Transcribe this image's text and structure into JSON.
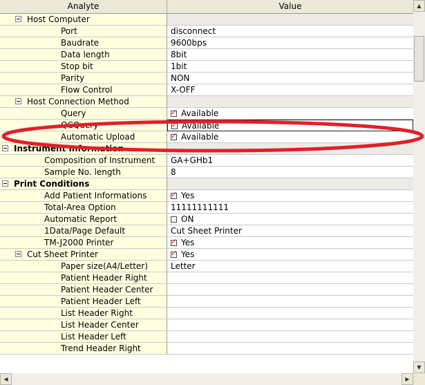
{
  "header": {
    "analyte": "Analyte",
    "value": "Value"
  },
  "rows": [
    {
      "label": "Host Computer",
      "value": "",
      "level": 1,
      "toggle": true,
      "bold": false,
      "group": true
    },
    {
      "label": "Port",
      "value": "disconnect",
      "level": 3
    },
    {
      "label": "Baudrate",
      "value": "9600bps",
      "level": 3
    },
    {
      "label": "Data length",
      "value": "8bit",
      "level": 3
    },
    {
      "label": "Stop bit",
      "value": "1bit",
      "level": 3
    },
    {
      "label": "Parity",
      "value": "NON",
      "level": 3
    },
    {
      "label": "Flow Control",
      "value": "X-OFF",
      "level": 3
    },
    {
      "label": "Host Connection Method",
      "value": "",
      "level": 1,
      "toggle": true,
      "group": true
    },
    {
      "label": "Query",
      "value": "Available",
      "level": 3,
      "checkbox": true,
      "checked": true
    },
    {
      "label": "QCQuery",
      "value": "Available",
      "level": 3,
      "checkbox": true,
      "checked": true,
      "selected": true
    },
    {
      "label": "Automatic Upload",
      "value": "Available",
      "level": 3,
      "checkbox": true,
      "checked": true
    },
    {
      "label": "Instrument Information",
      "value": "",
      "level": 0,
      "toggle": true,
      "bold": true,
      "group": true
    },
    {
      "label": "Composition of Instrument",
      "value": "GA+GHb1",
      "level": 2
    },
    {
      "label": "Sample No. length",
      "value": "8",
      "level": 2
    },
    {
      "label": "Print Conditions",
      "value": "",
      "level": 0,
      "toggle": true,
      "bold": true,
      "group": true
    },
    {
      "label": "Add Patient Informations",
      "value": "Yes",
      "level": 2,
      "checkbox": true,
      "checked": true
    },
    {
      "label": "Total-Area Option",
      "value": "11111111111",
      "level": 2
    },
    {
      "label": "Automatic Report",
      "value": "ON",
      "level": 2,
      "checkbox": true,
      "checked": false
    },
    {
      "label": "1Data/Page Default",
      "value": "Cut Sheet Printer",
      "level": 2
    },
    {
      "label": "TM-J2000 Printer",
      "value": "Yes",
      "level": 2,
      "checkbox": true,
      "checked": true
    },
    {
      "label": "Cut Sheet Printer",
      "value": "Yes",
      "level": 1,
      "toggle": true,
      "checkbox": true,
      "checked": true
    },
    {
      "label": "Paper size(A4/Letter)",
      "value": "Letter",
      "level": 3
    },
    {
      "label": "Patient Header Right",
      "value": "",
      "level": 3
    },
    {
      "label": "Patient Header Center",
      "value": "",
      "level": 3
    },
    {
      "label": "Patient Header Left",
      "value": "",
      "level": 3
    },
    {
      "label": "List Header Right",
      "value": "",
      "level": 3
    },
    {
      "label": "List Header Center",
      "value": "",
      "level": 3
    },
    {
      "label": "List Header Left",
      "value": "",
      "level": 3
    },
    {
      "label": "Trend Header Right",
      "value": "",
      "level": 3
    }
  ],
  "colors": {
    "label_bg": "#ffffe0",
    "group_value_bg": "#ecebe6",
    "check": "#e0202a",
    "highlight": "#e0202a"
  },
  "icons": {
    "toggle": "minus-box-icon",
    "check": "red-checkmark-icon"
  }
}
